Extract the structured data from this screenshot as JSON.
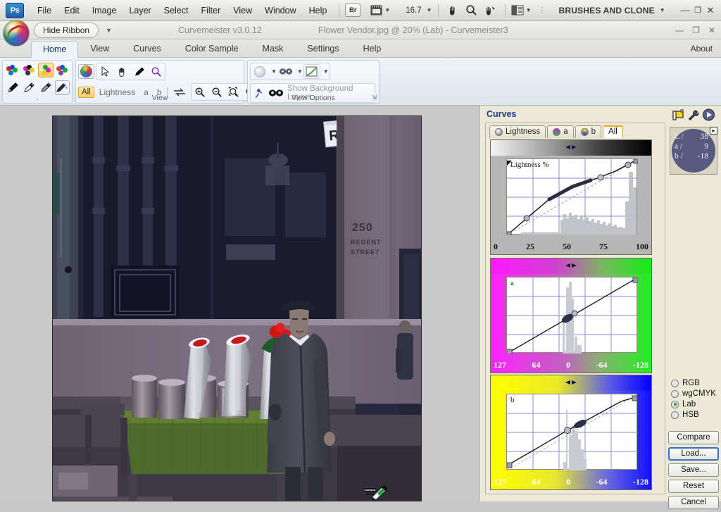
{
  "photoshop": {
    "logo": "Ps",
    "menus": [
      "File",
      "Edit",
      "Image",
      "Layer",
      "Select",
      "Filter",
      "View",
      "Window",
      "Help"
    ],
    "bridge_label": "Br",
    "zoom_value": "16.7",
    "workspace_label": "BRUSHES AND CLONE",
    "icons": {
      "bridge": "bridge-icon",
      "mini_bridge": "mini-bridge-icon",
      "hand": "hand-icon",
      "zoom": "zoom-icon",
      "rotate_view": "rotate-view-icon",
      "screen_mode": "screen-mode-icon"
    },
    "window_buttons": {
      "minimize": "—",
      "restore": "❐",
      "close": "✕"
    }
  },
  "curvemeister": {
    "hide_ribbon": "Hide Ribbon",
    "version": "Curvemeister v3.0.12",
    "document_title": "Flower Vendor.jpg @ 20% (Lab)  -  Curvemeister3",
    "window_buttons": {
      "minimize": "—",
      "restore": "❐",
      "close": "✕"
    },
    "tabs": [
      {
        "label": "Home",
        "active": true
      },
      {
        "label": "View",
        "active": false
      },
      {
        "label": "Curves",
        "active": false
      },
      {
        "label": "Color Sample",
        "active": false
      },
      {
        "label": "Mask",
        "active": false
      },
      {
        "label": "Settings",
        "active": false
      },
      {
        "label": "Help",
        "active": false
      }
    ],
    "about_label": "About"
  },
  "ribbon": {
    "groups": [
      {
        "name": "color-tools",
        "label": ".",
        "color_buttons": [
          {
            "name": "color-group-1",
            "selected": false
          },
          {
            "name": "color-group-2",
            "selected": false
          },
          {
            "name": "color-group-3",
            "selected": true
          },
          {
            "name": "color-group-4",
            "selected": false
          }
        ],
        "eyedroppers": [
          "eyedropper-black-icon",
          "eyedropper-white-icon",
          "eyedropper-gray-icon",
          "magic-eyedropper-icon"
        ]
      },
      {
        "name": "view",
        "label": "View",
        "tools": [
          "curvemeister-orb-icon",
          "arrow-select-icon",
          "hand-icon",
          "eyedropper-icon",
          "magnifier-icon"
        ],
        "channel_all": "All",
        "channel_names": [
          "Lightness",
          "a",
          "b"
        ],
        "swap_icon": "swap-icon",
        "zoom_tools": [
          "zoom-in-icon",
          "zoom-out-icon",
          "zoom-fit-icon",
          "zoom-actual-icon"
        ]
      },
      {
        "name": "view-options",
        "label": "View Options",
        "top_buttons": [
          "blur-preview-icon",
          "mask-glasses-icon",
          "curve-preview-icon"
        ],
        "pin_icon": "pin-icon",
        "glasses_icon": "glasses-icon",
        "show_bg_label": "Show Background Layers",
        "dialog_launcher": "dialog-launcher-icon"
      }
    ]
  },
  "curves_panel": {
    "title": "Curves",
    "tabs": [
      {
        "label": "Lightness",
        "active": false,
        "dot": "lightness-swatch"
      },
      {
        "label": "a",
        "active": false,
        "dot": "a-swatch"
      },
      {
        "label": "b",
        "active": false,
        "dot": "b-swatch"
      },
      {
        "label": "All",
        "active": true,
        "dot": null
      }
    ],
    "header_icons": [
      "flag-icon",
      "wrench-icon",
      "play-icon"
    ],
    "readout": {
      "rows": [
        {
          "channel": "L /",
          "value": "38"
        },
        {
          "channel": "a /",
          "value": "9"
        },
        {
          "channel": "b /",
          "value": "-18"
        }
      ],
      "expander": "▸"
    },
    "color_modes": [
      {
        "label": "RGB",
        "selected": false
      },
      {
        "label": "wgCMYK",
        "selected": false
      },
      {
        "label": "Lab",
        "selected": true
      },
      {
        "label": "HSB",
        "selected": false
      }
    ],
    "buttons": [
      {
        "label": "Compare",
        "focused": false
      },
      {
        "label": "Load...",
        "focused": true
      },
      {
        "label": "Save...",
        "focused": false
      },
      {
        "label": "Reset",
        "focused": false
      },
      {
        "label": "Cancel",
        "focused": false
      }
    ]
  },
  "chart_data": [
    {
      "type": "line",
      "name": "lightness-curve",
      "title": "Lightness %",
      "xlabel": "",
      "ylabel": "",
      "tick_labels": [
        "0",
        "25",
        "50",
        "75",
        "100"
      ],
      "xlim": [
        0,
        100
      ],
      "ylim": [
        0,
        100
      ],
      "grid": true,
      "gradient_from": "#f2f2f2",
      "gradient_to": "#000000",
      "series": [
        {
          "name": "curve",
          "x": [
            0,
            15,
            32,
            50,
            68,
            82,
            93,
            100
          ],
          "y": [
            0,
            22,
            47,
            64,
            74,
            84,
            93,
            100
          ]
        },
        {
          "name": "identity",
          "x": [
            0,
            100
          ],
          "y": [
            0,
            100
          ],
          "style": "dashed"
        }
      ],
      "control_points": [
        {
          "x": 0,
          "y": 0
        },
        {
          "x": 15,
          "y": 22
        },
        {
          "x": 72,
          "y": 77
        },
        {
          "x": 93,
          "y": 93
        },
        {
          "x": 100,
          "y": 100
        }
      ],
      "highlight_segment": {
        "x_from": 32,
        "x_to": 64
      },
      "histogram_peak_at": 100
    },
    {
      "type": "line",
      "name": "a-curve",
      "title": "a",
      "tick_labels": [
        "127",
        "64",
        "0",
        "-64",
        "-128"
      ],
      "xlim": [
        127,
        -128
      ],
      "ylim": [
        127,
        -128
      ],
      "grid": true,
      "gradient_from": "#ff00ff",
      "gradient_to": "#00ee00",
      "series": [
        {
          "name": "curve",
          "x": [
            127,
            -128
          ],
          "y": [
            127,
            -128
          ]
        },
        {
          "name": "identity",
          "x": [
            127,
            -128
          ],
          "y": [
            127,
            -128
          ],
          "style": "dashed"
        }
      ],
      "control_points": [
        {
          "x": 127,
          "y": 127
        },
        {
          "x": 9,
          "y": 9
        },
        {
          "x": -128,
          "y": -128
        }
      ],
      "histogram_peak_at": 5
    },
    {
      "type": "line",
      "name": "b-curve",
      "title": "b",
      "tick_labels": [
        "127",
        "64",
        "0",
        "-64",
        "-128"
      ],
      "xlim": [
        127,
        -128
      ],
      "ylim": [
        127,
        -128
      ],
      "grid": true,
      "gradient_from": "#ffff00",
      "gradient_to": "#0000ff",
      "series": [
        {
          "name": "curve",
          "x": [
            127,
            60,
            0,
            -40,
            -110
          ],
          "y": [
            118,
            55,
            8,
            -32,
            -108
          ]
        },
        {
          "name": "identity",
          "x": [
            127,
            -128
          ],
          "y": [
            127,
            -128
          ],
          "style": "dashed"
        }
      ],
      "control_points": [
        {
          "x": 127,
          "y": 118
        },
        {
          "x": 8,
          "y": 12
        },
        {
          "x": -18,
          "y": -8
        },
        {
          "x": -110,
          "y": -108
        }
      ],
      "histogram_peak_at": -20
    }
  ],
  "photo": {
    "street_sign": "REGENT STREET",
    "wall_address_number": "250",
    "wall_address_line2": "REGENT",
    "wall_address_line3": "STREET"
  },
  "cursor": {
    "name": "eyedropper-cursor"
  }
}
